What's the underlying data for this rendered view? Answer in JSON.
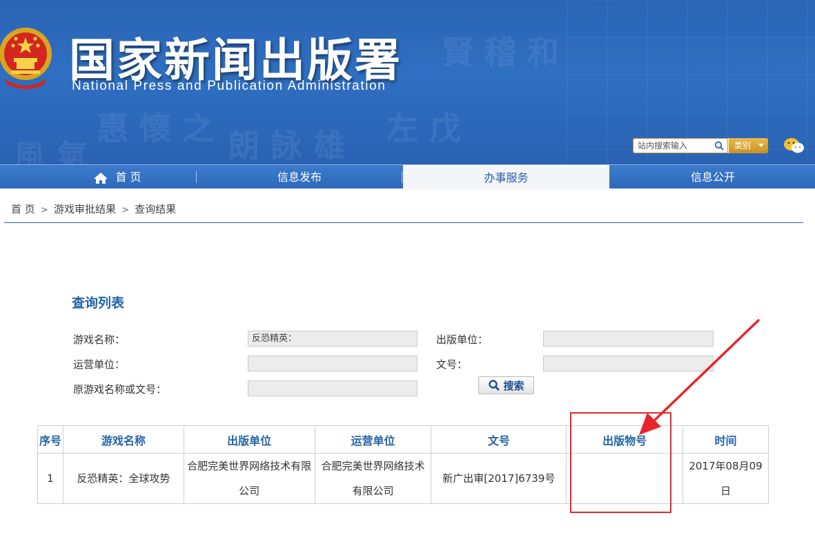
{
  "header": {
    "title": "国家新闻出版署",
    "subtitle": "National  Press and Publication Administration",
    "search": {
      "placeholder": "站内搜索输入",
      "category_label": "类别"
    }
  },
  "nav": {
    "items": [
      {
        "label": "首 页",
        "icon": "home-icon"
      },
      {
        "label": "信息发布"
      },
      {
        "label": "办事服务",
        "active": true
      },
      {
        "label": "信息公开"
      }
    ]
  },
  "breadcrumb": [
    "首 页",
    "游戏审批结果",
    "查询结果"
  ],
  "query": {
    "title": "查询列表",
    "fields": {
      "game_name": {
        "label": "游戏名称：",
        "value": "反恐精英："
      },
      "publisher": {
        "label": "出版单位：",
        "value": ""
      },
      "operator": {
        "label": "运营单位：",
        "value": ""
      },
      "doc_no": {
        "label": "文号：",
        "value": ""
      },
      "original": {
        "label": "原游戏名称或文号：",
        "value": ""
      }
    },
    "search_button": "搜索"
  },
  "table": {
    "headers": [
      "序号",
      "游戏名称",
      "出版单位",
      "运营单位",
      "文号",
      "出版物号",
      "时间"
    ],
    "rows": [
      [
        "1",
        "反恐精英：全球攻势",
        "合肥完美世界网络技术有限公司",
        "合肥完美世界网络技术有限公司",
        "新广出审[2017]6739号",
        "",
        "2017年08月09日"
      ]
    ]
  },
  "colors": {
    "brand_blue": "#2f6fc2",
    "nav_blue": "#3c7bcc",
    "heading_blue": "#2364a8",
    "annotation_red": "#e8242a",
    "search_gold": "#c9921f"
  }
}
